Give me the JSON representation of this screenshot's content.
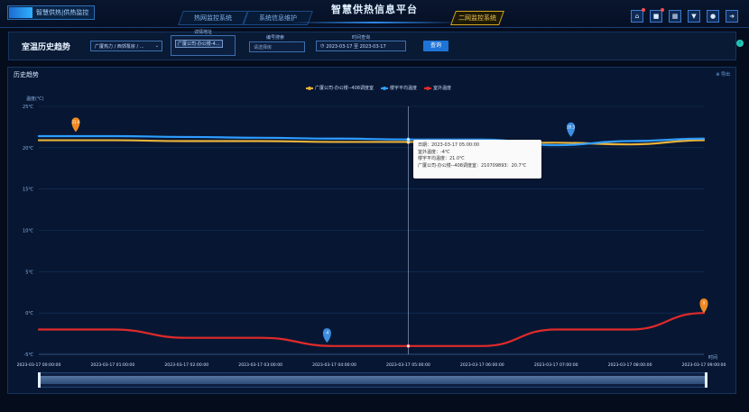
{
  "app": {
    "logo_text": "智慧供热|供热监控"
  },
  "nav": {
    "item1": "热网监控系统",
    "item2": "系统信息维护",
    "title": "智慧供热信息平台",
    "item3": "二网监控系统"
  },
  "toolbar_icons": [
    "home-icon",
    "alert-icon",
    "grid-icon",
    "filter-icon",
    "user-icon",
    "logout-icon"
  ],
  "filters": {
    "page_title": "室温历史趋势",
    "company_select": "广厦热力 / 西郊泵房 / ...",
    "detail_label": "详情地址",
    "detail_tag": "广厦公司-办公楼-4...",
    "device_label": "编号搜索",
    "device_placeholder": "请选择房",
    "time_label": "时间查询",
    "time_range": "2023-03-17 至 2023-03-17",
    "query_button": "查询"
  },
  "panel": {
    "title": "历史趋势",
    "export": "导出"
  },
  "chart_data": {
    "type": "line",
    "ylabel": "温度(℃)",
    "xlabel": "时间",
    "ylim": [
      0,
      25
    ],
    "y_ticks": [
      "25℃",
      "20℃",
      "15℃",
      "10℃",
      "5℃",
      "0℃",
      "-5℃"
    ],
    "x": [
      "2023-03-17 00:00:00",
      "2023-03-17 01:00:00",
      "2023-03-17 02:00:00",
      "2023-03-17 03:00:00",
      "2023-03-17 04:00:00",
      "2023-03-17 05:00:00",
      "2023-03-17 06:00:00",
      "2023-03-17 07:00:00",
      "2023-03-17 08:00:00",
      "2023-03-17 09:00:00"
    ],
    "series": [
      {
        "name": "广厦公司-办公楼--408调度室",
        "color": "#e8b23a",
        "x": [
          0,
          1,
          2,
          3,
          4,
          5,
          6,
          7,
          8,
          9
        ],
        "values": [
          20.9,
          20.9,
          20.8,
          20.8,
          20.7,
          20.7,
          20.6,
          20.6,
          20.4,
          20.9
        ]
      },
      {
        "name": "楼宇平均温度",
        "color": "#2f9dff",
        "x": [
          0,
          1,
          2,
          3,
          4,
          5,
          6,
          7,
          8,
          9
        ],
        "values": [
          21.4,
          21.4,
          21.3,
          21.2,
          21.1,
          21.0,
          21.0,
          20.3,
          20.8,
          21.1
        ]
      },
      {
        "name": "室外温度",
        "color": "#e12a2a",
        "x": [
          0,
          1,
          2,
          3,
          4,
          5,
          6,
          7,
          8,
          9
        ],
        "values": [
          -2.0,
          -2.0,
          -3.0,
          -3.0,
          -4.0,
          -4.0,
          -4.0,
          -2.0,
          -2.0,
          0.0
        ]
      }
    ],
    "markers": [
      {
        "label": "21.9",
        "color": "#f08a24",
        "x": 0.5,
        "y": 21.9
      },
      {
        "label": "20.3",
        "color": "#3d8ee0",
        "x": 7.2,
        "y": 21.3
      },
      {
        "label": "-4",
        "color": "#3d8ee0",
        "x": 3.9,
        "y": -3.6
      },
      {
        "label": "0",
        "color": "#f08a24",
        "x": 9.0,
        "y": 0.0
      }
    ],
    "crosshair_x": 5,
    "tooltip": {
      "date": "日期：2023-03-17 05:00:00",
      "outdoor": "室外温度：-4℃",
      "avg": "楼宇平均温度：21.0℃",
      "room": "广厦公司-办公楼--408调度室：210709893：20.7℃"
    }
  }
}
